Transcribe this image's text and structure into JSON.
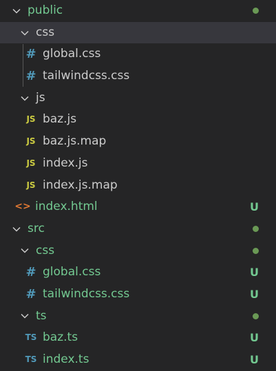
{
  "colors": {
    "background": "#252526",
    "selected_row": "#37373d",
    "untracked_green": "#73c991",
    "default_text": "#cccccc",
    "css_icon_blue": "#519aba",
    "js_icon_yellow": "#cbcb41",
    "html_icon_orange": "#e37933",
    "dot_green": "#6a9955"
  },
  "explorer": {
    "rows": [
      {
        "label": "public",
        "icon": "chevron-down-icon",
        "status": "dot"
      },
      {
        "label": "css",
        "icon": "chevron-down-icon",
        "status": ""
      },
      {
        "label": "global.css",
        "icon": "css-hash-icon",
        "status": ""
      },
      {
        "label": "tailwindcss.css",
        "icon": "css-hash-icon",
        "status": ""
      },
      {
        "label": "js",
        "icon": "chevron-down-icon",
        "status": ""
      },
      {
        "label": "baz.js",
        "icon": "js-file-icon",
        "icon_text": "JS",
        "status": ""
      },
      {
        "label": "baz.js.map",
        "icon": "js-file-icon",
        "icon_text": "JS",
        "status": ""
      },
      {
        "label": "index.js",
        "icon": "js-file-icon",
        "icon_text": "JS",
        "status": ""
      },
      {
        "label": "index.js.map",
        "icon": "js-file-icon",
        "icon_text": "JS",
        "status": ""
      },
      {
        "label": "index.html",
        "icon": "html-file-icon",
        "icon_text": "<>",
        "status": "U"
      },
      {
        "label": "src",
        "icon": "chevron-down-icon",
        "status": "dot"
      },
      {
        "label": "css",
        "icon": "chevron-down-icon",
        "status": "dot"
      },
      {
        "label": "global.css",
        "icon": "css-hash-icon",
        "status": "U"
      },
      {
        "label": "tailwindcss.css",
        "icon": "css-hash-icon",
        "status": "U"
      },
      {
        "label": "ts",
        "icon": "chevron-down-icon",
        "status": "dot"
      },
      {
        "label": "baz.ts",
        "icon": "ts-file-icon",
        "icon_text": "TS",
        "status": "U"
      },
      {
        "label": "index.ts",
        "icon": "ts-file-icon",
        "icon_text": "TS",
        "status": "U"
      }
    ]
  }
}
